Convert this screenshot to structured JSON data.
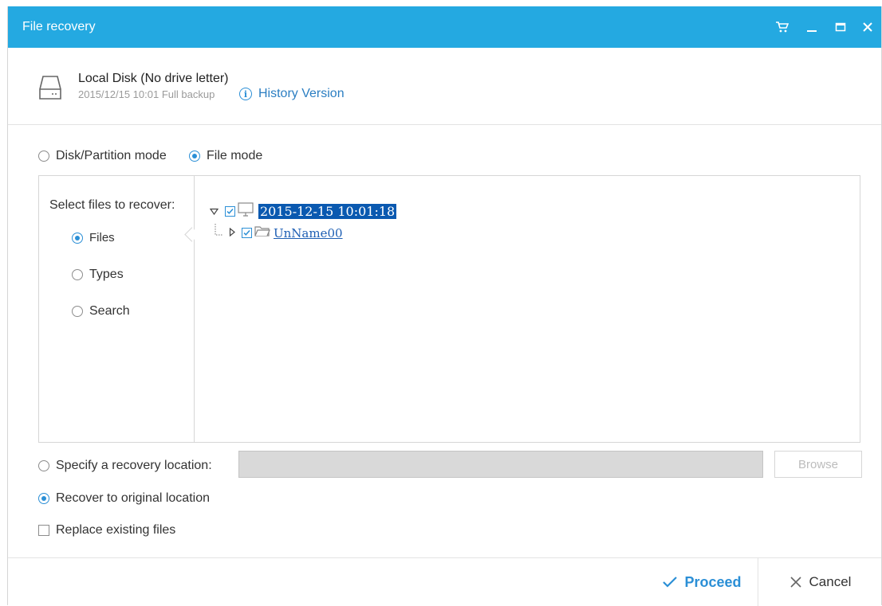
{
  "window": {
    "title": "File recovery"
  },
  "titlebar": {
    "cart_icon": "cart-icon",
    "minimize_icon": "minimize-icon",
    "maximize_icon": "maximize-icon",
    "close_icon": "close-icon"
  },
  "source": {
    "name": "Local Disk (No drive letter)",
    "subtitle": "2015/12/15 10:01 Full backup",
    "history_link": "History Version"
  },
  "modes": {
    "disk_partition": "Disk/Partition mode",
    "file": "File mode",
    "selected": "file"
  },
  "left_panel": {
    "caption": "Select files to recover:",
    "options": [
      {
        "label": "Files",
        "selected": true
      },
      {
        "label": "Types",
        "selected": false
      },
      {
        "label": "Search",
        "selected": false
      }
    ]
  },
  "tree": {
    "root": {
      "label": "2015-12-15 10:01:18",
      "checked": true,
      "expanded": true
    },
    "children": [
      {
        "label": "UnName00",
        "checked": true,
        "expanded": false
      }
    ]
  },
  "destination": {
    "specify_label": "Specify a recovery location:",
    "path_value": "",
    "browse_label": "Browse",
    "original_label": "Recover to original location",
    "selected": "original"
  },
  "replace": {
    "label": "Replace existing files",
    "checked": false
  },
  "footer": {
    "proceed": "Proceed",
    "cancel": "Cancel"
  },
  "colors": {
    "titlebar": "#24a9e1",
    "accent": "#2b8fd6",
    "selection": "#0a59b0"
  }
}
